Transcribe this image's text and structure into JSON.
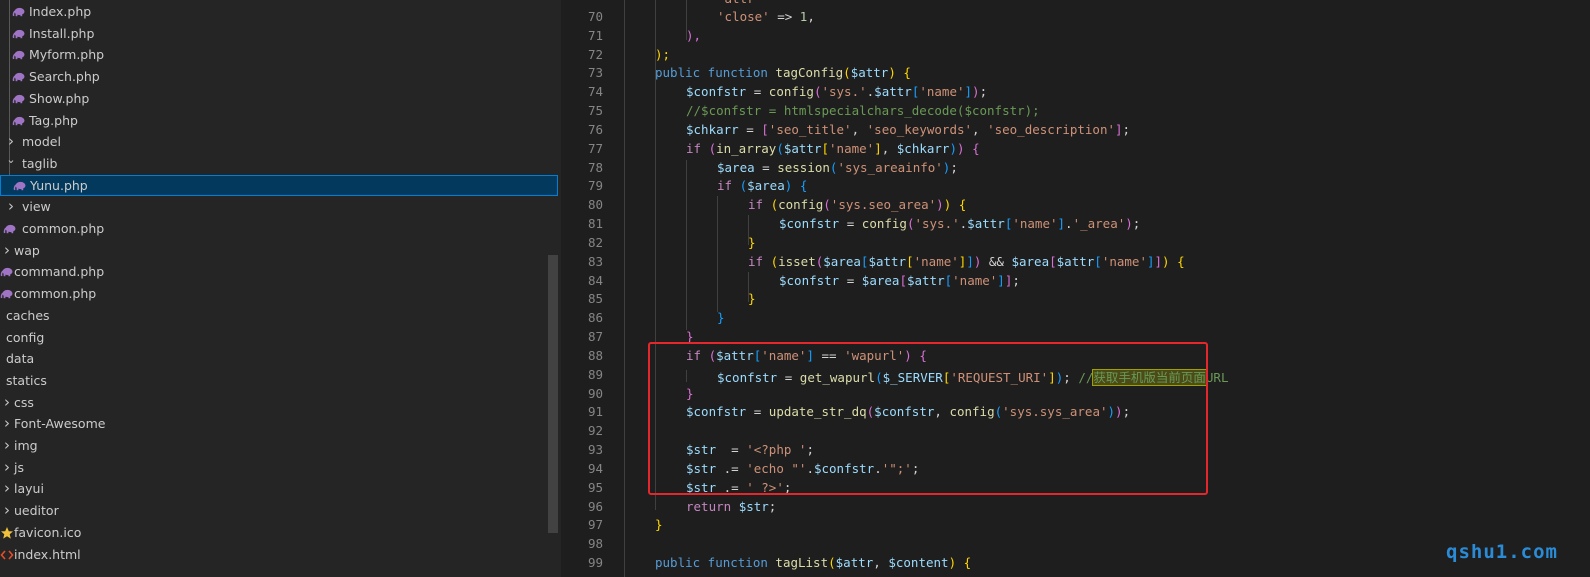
{
  "colors": {
    "php_icon": "#a074c4",
    "favicon": "#f0c23b",
    "html_icon": "#e44d26",
    "selection_bg": "#04395e",
    "selection_border": "#007fd4",
    "annotation": "#e3272d",
    "watermark": "#2a8bd6"
  },
  "explorer": {
    "items": [
      {
        "label": "Index.php",
        "kind": "file",
        "icon": "php-elephant-icon"
      },
      {
        "label": "Install.php",
        "kind": "file",
        "icon": "php-elephant-icon"
      },
      {
        "label": "Myform.php",
        "kind": "file",
        "icon": "php-elephant-icon"
      },
      {
        "label": "Search.php",
        "kind": "file",
        "icon": "php-elephant-icon"
      },
      {
        "label": "Show.php",
        "kind": "file",
        "icon": "php-elephant-icon"
      },
      {
        "label": "Tag.php",
        "kind": "file",
        "icon": "php-elephant-icon"
      },
      {
        "label": "model",
        "kind": "folder",
        "expanded": false
      },
      {
        "label": "taglib",
        "kind": "folder",
        "expanded": true
      },
      {
        "label": "Yunu.php",
        "kind": "file",
        "icon": "php-elephant-icon",
        "selected": true
      },
      {
        "label": "view",
        "kind": "folder",
        "expanded": false
      },
      {
        "label": "common.php",
        "kind": "file",
        "icon": "php-elephant-icon"
      },
      {
        "label": "wap",
        "kind": "folder",
        "expanded": false
      },
      {
        "label": "command.php",
        "kind": "file",
        "icon": "php-elephant-icon"
      },
      {
        "label": "common.php",
        "kind": "file",
        "icon": "php-elephant-icon"
      },
      {
        "label": "caches",
        "kind": "folder-noarrow"
      },
      {
        "label": "config",
        "kind": "folder-noarrow"
      },
      {
        "label": "data",
        "kind": "folder-noarrow"
      },
      {
        "label": "statics",
        "kind": "folder-noarrow"
      },
      {
        "label": "css",
        "kind": "folder",
        "expanded": false
      },
      {
        "label": "Font-Awesome",
        "kind": "folder",
        "expanded": false
      },
      {
        "label": "img",
        "kind": "folder",
        "expanded": false
      },
      {
        "label": "js",
        "kind": "folder",
        "expanded": false
      },
      {
        "label": "layui",
        "kind": "folder",
        "expanded": false
      },
      {
        "label": "ueditor",
        "kind": "folder",
        "expanded": false
      },
      {
        "label": "favicon.ico",
        "kind": "file",
        "icon": "star-icon"
      },
      {
        "label": "index.html",
        "kind": "file",
        "icon": "html-code-icon"
      }
    ]
  },
  "editor": {
    "lines": [
      {
        "n": "70",
        "tokens": [
          [
            "s",
            "'close'"
          ],
          [
            "p",
            " => "
          ],
          [
            "n",
            "1"
          ],
          [
            "p",
            ","
          ]
        ]
      },
      {
        "n": "71",
        "tokens": [
          [
            "b2",
            "),"
          ]
        ]
      },
      {
        "n": "72",
        "tokens": [
          [
            "b1",
            ");"
          ]
        ]
      },
      {
        "n": "73",
        "tokens": [
          [
            "k",
            "public function "
          ],
          [
            "f",
            "tagConfig"
          ],
          [
            "b1",
            "("
          ],
          [
            "v",
            "$attr"
          ],
          [
            "b1",
            ")"
          ],
          [
            "p",
            " "
          ],
          [
            "b1",
            "{"
          ]
        ]
      },
      {
        "n": "74",
        "tokens": [
          [
            "v",
            "$confstr"
          ],
          [
            "p",
            " = "
          ],
          [
            "f",
            "config"
          ],
          [
            "b2",
            "("
          ],
          [
            "s",
            "'sys.'"
          ],
          [
            "p",
            "."
          ],
          [
            "v",
            "$attr"
          ],
          [
            "b3",
            "["
          ],
          [
            "s",
            "'name'"
          ],
          [
            "b3",
            "]"
          ],
          [
            "b2",
            ")"
          ],
          [
            "p",
            ";"
          ]
        ]
      },
      {
        "n": "75",
        "tokens": [
          [
            "c",
            "//$confstr = htmlspecialchars_decode($confstr);"
          ]
        ]
      },
      {
        "n": "76",
        "tokens": [
          [
            "v",
            "$chkarr"
          ],
          [
            "p",
            " = "
          ],
          [
            "b2",
            "["
          ],
          [
            "s",
            "'seo_title'"
          ],
          [
            "p",
            ", "
          ],
          [
            "s",
            "'seo_keywords'"
          ],
          [
            "p",
            ", "
          ],
          [
            "s",
            "'seo_description'"
          ],
          [
            "b2",
            "]"
          ],
          [
            "p",
            ";"
          ]
        ]
      },
      {
        "n": "77",
        "tokens": [
          [
            "x",
            "if "
          ],
          [
            "b2",
            "("
          ],
          [
            "f",
            "in_array"
          ],
          [
            "b3",
            "("
          ],
          [
            "v",
            "$attr"
          ],
          [
            "b1",
            "["
          ],
          [
            "s",
            "'name'"
          ],
          [
            "b1",
            "]"
          ],
          [
            "p",
            ", "
          ],
          [
            "v",
            "$chkarr"
          ],
          [
            "b3",
            ")"
          ],
          [
            "b2",
            ")"
          ],
          [
            "p",
            " "
          ],
          [
            "b2",
            "{"
          ]
        ]
      },
      {
        "n": "78",
        "tokens": [
          [
            "v",
            "$area"
          ],
          [
            "p",
            " = "
          ],
          [
            "f",
            "session"
          ],
          [
            "b3",
            "("
          ],
          [
            "s",
            "'sys_areainfo'"
          ],
          [
            "b3",
            ")"
          ],
          [
            "p",
            ";"
          ]
        ]
      },
      {
        "n": "79",
        "tokens": [
          [
            "x",
            "if "
          ],
          [
            "b3",
            "("
          ],
          [
            "v",
            "$area"
          ],
          [
            "b3",
            ")"
          ],
          [
            "p",
            " "
          ],
          [
            "b3",
            "{"
          ]
        ]
      },
      {
        "n": "80",
        "tokens": [
          [
            "x",
            "if "
          ],
          [
            "b1",
            "("
          ],
          [
            "f",
            "config"
          ],
          [
            "b2",
            "("
          ],
          [
            "s",
            "'sys.seo_area'"
          ],
          [
            "b2",
            ")"
          ],
          [
            "b1",
            ")"
          ],
          [
            "p",
            " "
          ],
          [
            "b1",
            "{"
          ]
        ]
      },
      {
        "n": "81",
        "tokens": [
          [
            "v",
            "$confstr"
          ],
          [
            "p",
            " = "
          ],
          [
            "f",
            "config"
          ],
          [
            "b2",
            "("
          ],
          [
            "s",
            "'sys.'"
          ],
          [
            "p",
            "."
          ],
          [
            "v",
            "$attr"
          ],
          [
            "b3",
            "["
          ],
          [
            "s",
            "'name'"
          ],
          [
            "b3",
            "]"
          ],
          [
            "p",
            "."
          ],
          [
            "s",
            "'_area'"
          ],
          [
            "b2",
            ")"
          ],
          [
            "p",
            ";"
          ]
        ]
      },
      {
        "n": "82",
        "tokens": [
          [
            "b1",
            "}"
          ]
        ]
      },
      {
        "n": "83",
        "tokens": [
          [
            "x",
            "if "
          ],
          [
            "b1",
            "("
          ],
          [
            "f",
            "isset"
          ],
          [
            "b2",
            "("
          ],
          [
            "v",
            "$area"
          ],
          [
            "b3",
            "["
          ],
          [
            "v",
            "$attr"
          ],
          [
            "b1",
            "["
          ],
          [
            "s",
            "'name'"
          ],
          [
            "b1",
            "]"
          ],
          [
            "b3",
            "]"
          ],
          [
            "b2",
            ")"
          ],
          [
            "p",
            " && "
          ],
          [
            "v",
            "$area"
          ],
          [
            "b2",
            "["
          ],
          [
            "v",
            "$attr"
          ],
          [
            "b3",
            "["
          ],
          [
            "s",
            "'name'"
          ],
          [
            "b3",
            "]"
          ],
          [
            "b2",
            "]"
          ],
          [
            "b1",
            ")"
          ],
          [
            "p",
            " "
          ],
          [
            "b1",
            "{"
          ]
        ]
      },
      {
        "n": "84",
        "tokens": [
          [
            "v",
            "$confstr"
          ],
          [
            "p",
            " = "
          ],
          [
            "v",
            "$area"
          ],
          [
            "b2",
            "["
          ],
          [
            "v",
            "$attr"
          ],
          [
            "b3",
            "["
          ],
          [
            "s",
            "'name'"
          ],
          [
            "b3",
            "]"
          ],
          [
            "b2",
            "]"
          ],
          [
            "p",
            ";"
          ]
        ]
      },
      {
        "n": "85",
        "tokens": [
          [
            "b1",
            "}"
          ]
        ]
      },
      {
        "n": "86",
        "tokens": [
          [
            "b3",
            "}"
          ]
        ]
      },
      {
        "n": "87",
        "tokens": [
          [
            "b2",
            "}"
          ]
        ]
      },
      {
        "n": "88",
        "tokens": [
          [
            "x",
            "if "
          ],
          [
            "b2",
            "("
          ],
          [
            "v",
            "$attr"
          ],
          [
            "b3",
            "["
          ],
          [
            "s",
            "'name'"
          ],
          [
            "b3",
            "]"
          ],
          [
            "p",
            " == "
          ],
          [
            "s",
            "'wapurl'"
          ],
          [
            "b2",
            ")"
          ],
          [
            "p",
            " "
          ],
          [
            "b2",
            "{"
          ]
        ]
      },
      {
        "n": "89",
        "tokens": [
          [
            "v",
            "$confstr"
          ],
          [
            "p",
            " = "
          ],
          [
            "f",
            "get_wapurl"
          ],
          [
            "b3",
            "("
          ],
          [
            "v",
            "$_SERVER"
          ],
          [
            "b1",
            "["
          ],
          [
            "s",
            "'REQUEST_URI'"
          ],
          [
            "b1",
            "]"
          ],
          [
            "b3",
            ")"
          ],
          [
            "p",
            "; "
          ],
          [
            "c",
            "//"
          ],
          [
            "ch",
            "获取手机版当前页面"
          ],
          [
            "c",
            "URL"
          ]
        ]
      },
      {
        "n": "90",
        "tokens": [
          [
            "b2",
            "}"
          ]
        ]
      },
      {
        "n": "91",
        "tokens": [
          [
            "v",
            "$confstr"
          ],
          [
            "p",
            " = "
          ],
          [
            "f",
            "update_str_dq"
          ],
          [
            "b2",
            "("
          ],
          [
            "v",
            "$confstr"
          ],
          [
            "p",
            ", "
          ],
          [
            "f",
            "config"
          ],
          [
            "b3",
            "("
          ],
          [
            "s",
            "'sys.sys_area'"
          ],
          [
            "b3",
            ")"
          ],
          [
            "b2",
            ")"
          ],
          [
            "p",
            ";"
          ]
        ]
      },
      {
        "n": "92",
        "tokens": []
      },
      {
        "n": "93",
        "tokens": [
          [
            "v",
            "$str"
          ],
          [
            "p",
            "  = "
          ],
          [
            "s",
            "'<?php '"
          ],
          [
            "p",
            ";"
          ]
        ]
      },
      {
        "n": "94",
        "tokens": [
          [
            "v",
            "$str"
          ],
          [
            "p",
            " .= "
          ],
          [
            "s",
            "'echo \"'"
          ],
          [
            "p",
            "."
          ],
          [
            "v",
            "$confstr"
          ],
          [
            "p",
            "."
          ],
          [
            "s",
            "'\";'"
          ],
          [
            "p",
            ";"
          ]
        ]
      },
      {
        "n": "95",
        "tokens": [
          [
            "v",
            "$str"
          ],
          [
            "p",
            " .= "
          ],
          [
            "s",
            "' ?>'"
          ],
          [
            "p",
            ";"
          ]
        ]
      },
      {
        "n": "96",
        "tokens": [
          [
            "x",
            "return "
          ],
          [
            "v",
            "$str"
          ],
          [
            "p",
            ";"
          ]
        ]
      },
      {
        "n": "97",
        "tokens": [
          [
            "b1",
            "}"
          ]
        ]
      },
      {
        "n": "98",
        "tokens": []
      },
      {
        "n": "99",
        "tokens": [
          [
            "k",
            "public function "
          ],
          [
            "f",
            "tagList"
          ],
          [
            "b1",
            "("
          ],
          [
            "v",
            "$attr"
          ],
          [
            "p",
            ", "
          ],
          [
            "v",
            "$content"
          ],
          [
            "b1",
            ")"
          ],
          [
            "p",
            " "
          ],
          [
            "b1",
            "{"
          ]
        ]
      }
    ]
  },
  "watermark": "qshu1.com"
}
